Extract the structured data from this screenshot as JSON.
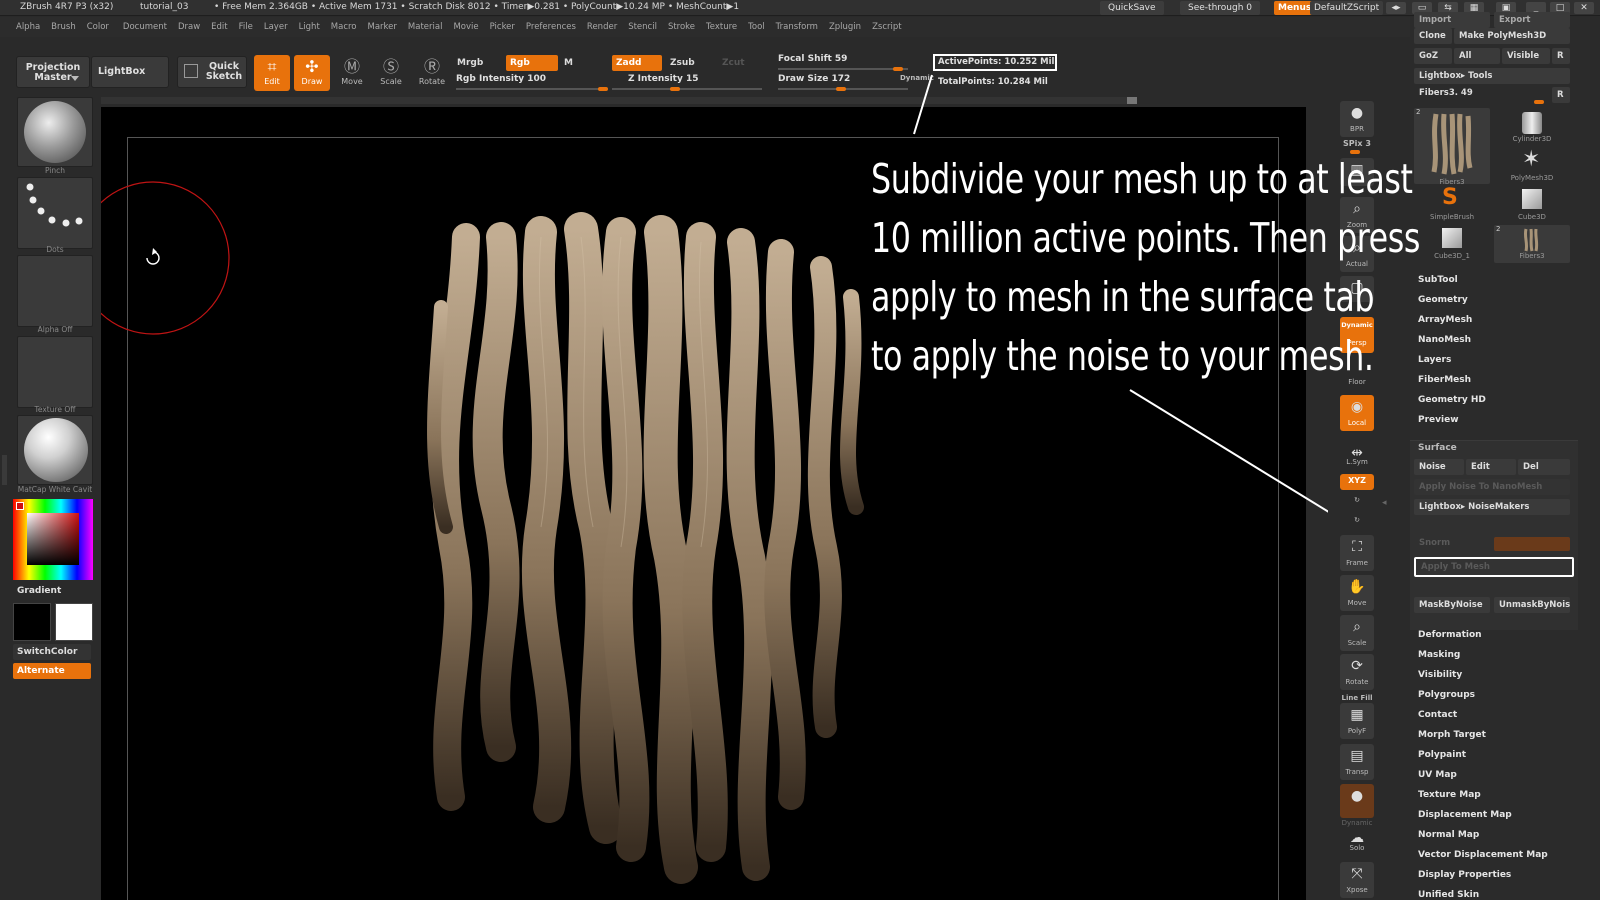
{
  "titlebar": {
    "app": "ZBrush 4R7 P3 (x32)",
    "doc": "tutorial_03",
    "stats": "• Free Mem 2.364GB  • Active Mem 1731  • Scratch Disk 8012  •  Timer▶0.281  • PolyCount▶10.24 MP   • MeshCount▶1",
    "quicksave": "QuickSave",
    "see_through": "See-through  0",
    "menus": "Menus",
    "script": "DefaultZScript"
  },
  "menubar": {
    "items": [
      "Alpha",
      "Brush",
      "Color",
      "Document",
      "Draw",
      "Edit",
      "File",
      "Layer",
      "Light",
      "Macro",
      "Marker",
      "Material",
      "Movie",
      "Picker",
      "Preferences",
      "Render",
      "Stencil",
      "Stroke",
      "Texture",
      "Tool",
      "Transform",
      "Zplugin",
      "Zscript"
    ]
  },
  "toolbar": {
    "projection_master": "Projection Master",
    "lightbox": "LightBox",
    "quick_sketch": "Quick Sketch",
    "edit": "Edit",
    "draw": "Draw",
    "move": "Move",
    "scale": "Scale",
    "rotate": "Rotate",
    "mrgb": "Mrgb",
    "rgb": "Rgb",
    "m": "M",
    "rgb_intensity": "Rgb Intensity 100",
    "zadd": "Zadd",
    "zsub": "Zsub",
    "zcut": "Zcut",
    "z_intensity": "Z Intensity 15",
    "focal_shift": "Focal Shift 59",
    "draw_size": "Draw Size 172",
    "dynamic": "Dynamic",
    "active_points": "ActivePoints: 10.252  Mil",
    "total_points": "TotalPoints: 10.284  Mil"
  },
  "left_shelf": {
    "brush_cap": "Pinch",
    "stroke_cap": "Dots",
    "alpha_cap": "Alpha  Off",
    "texture_cap": "Texture  Off",
    "material_cap": "MatCap  White  Cavit",
    "gradient": "Gradient",
    "switch_color": "SwitchColor",
    "alternate": "Alternate"
  },
  "right_shelf": {
    "bpr": "BPR",
    "spix": "SPix 3",
    "zoom": "Zoom",
    "actual": "Actual",
    "dynamic_persp": "Dynamic",
    "persp": "Persp",
    "floor": "Floor",
    "local": "Local",
    "lsym": "L.Sym",
    "xyz": "XYZ",
    "frame": "Frame",
    "move": "Move",
    "scale": "Scale",
    "rotate": "Rotate",
    "line_fill": "Line Fill",
    "polyf": "PolyF",
    "transp": "Transp",
    "dynamic_solo": "Dynamic",
    "solo": "Solo",
    "xpose": "Xpose"
  },
  "panel": {
    "import": "Import",
    "export": "Export",
    "clone": "Clone",
    "make_polymesh": "Make PolyMesh3D",
    "goz": "GoZ",
    "all": "All",
    "visible": "Visible",
    "r": "R",
    "lightbox_tools": "Lightbox▸ Tools",
    "current_tool": "Fibers3. 49",
    "thumbs": [
      {
        "label": "Fibers3",
        "count": "2"
      },
      {
        "label": "Cylinder3D"
      },
      {
        "label": "PolyMesh3D"
      },
      {
        "label": "SimpleBrush"
      },
      {
        "label": "Cube3D"
      },
      {
        "label": "Cube3D_1"
      },
      {
        "label": "Fibers3",
        "count": "2"
      }
    ],
    "sections_top": [
      "SubTool",
      "Geometry",
      "ArrayMesh",
      "NanoMesh",
      "Layers",
      "FiberMesh",
      "Geometry HD",
      "Preview"
    ],
    "surface_title": "Surface",
    "noise": "Noise",
    "edit": "Edit",
    "del": "Del",
    "apply_noise_nanomesh": "Apply Noise To NanoMesh",
    "lightbox_noisemakers": "Lightbox▸ NoiseMakers",
    "snorm": "Snorm",
    "apply_to_mesh": "Apply To Mesh",
    "mask_by_noise": "MaskByNoise",
    "unmask_by_noise": "UnmaskByNoise",
    "sections_bottom": [
      "Deformation",
      "Masking",
      "Visibility",
      "Polygroups",
      "Contact",
      "Morph Target",
      "Polypaint",
      "UV Map",
      "Texture Map",
      "Displacement Map",
      "Normal Map",
      "Vector Displacement Map",
      "Display Properties",
      "Unified Skin"
    ]
  },
  "annotation": {
    "lines": [
      "Subdivide your mesh up to at least",
      "10 million active points. Then press",
      "apply to mesh in the surface tab",
      "to apply the noise to your mesh."
    ]
  },
  "colors": {
    "accent": "#e8720c",
    "background": "#2a2a2a",
    "canvas": "#000000",
    "brush_circle": "#c01414"
  }
}
